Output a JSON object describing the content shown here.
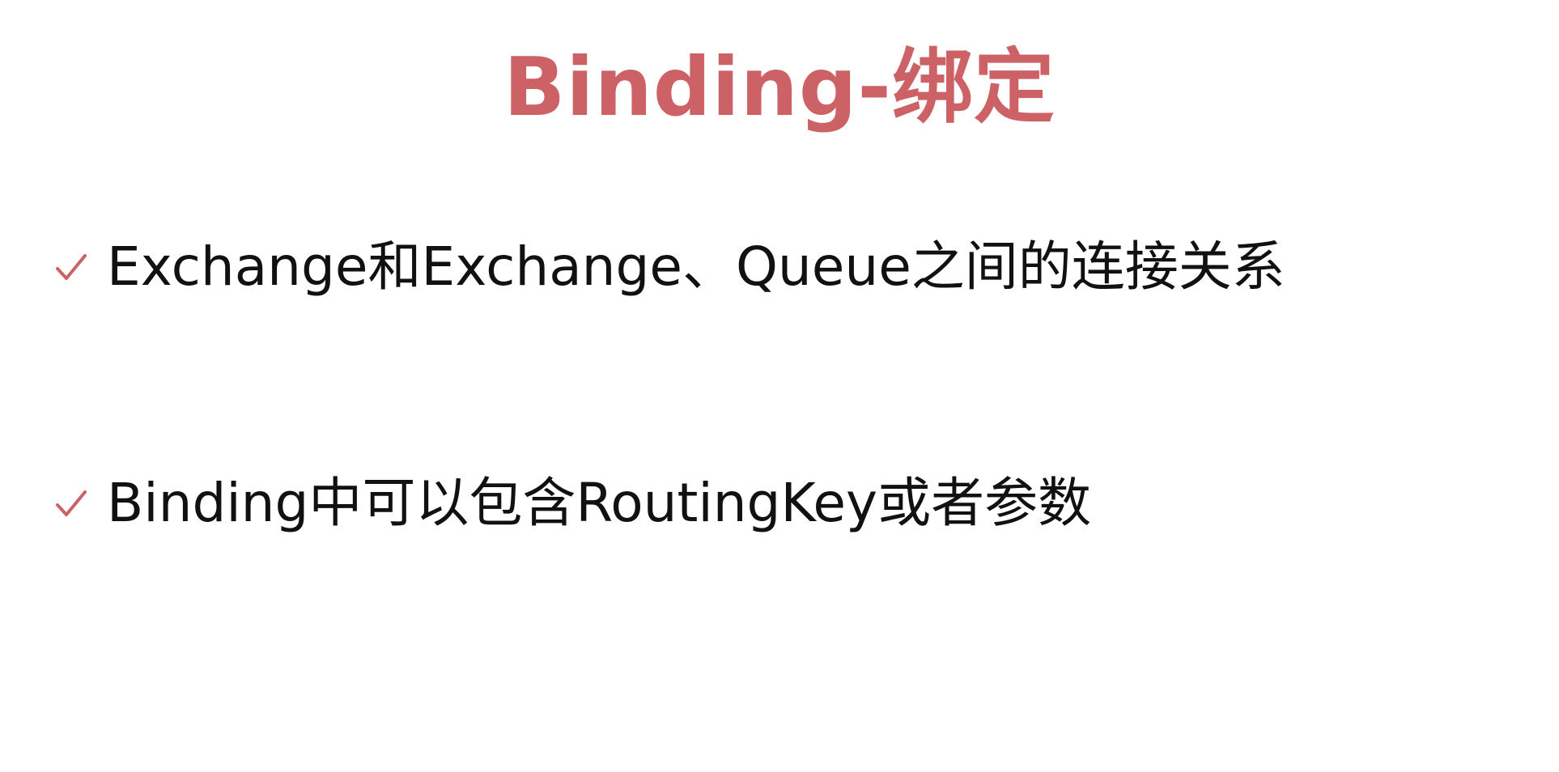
{
  "slide": {
    "title": "Binding-绑定",
    "bullets": [
      {
        "icon": "check-icon",
        "text": "Exchange和Exchange、Queue之间的连接关系"
      },
      {
        "icon": "check-icon",
        "text": "Binding中可以包含RoutingKey或者参数"
      }
    ]
  },
  "colors": {
    "title": "#cd6266",
    "check": "#cd6266",
    "text": "#111111",
    "background": "#ffffff"
  }
}
